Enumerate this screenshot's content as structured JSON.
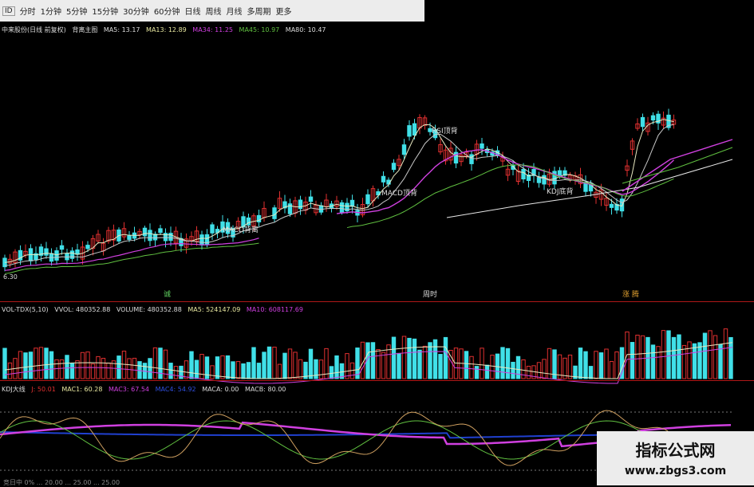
{
  "toolbar": {
    "items": [
      "分时",
      "1分钟",
      "5分钟",
      "15分钟",
      "30分钟",
      "60分钟",
      "日线",
      "周线",
      "月线",
      "多周期",
      "更多"
    ],
    "first_icon": "ID"
  },
  "main_info": {
    "stock": "中来股份(日线 前复权)",
    "indicator": "背离主图",
    "ma5": "MA5: 13.17",
    "ma13": "MA13: 12.89",
    "ma34": "MA34: 11.25",
    "ma45": "MA45: 10.97",
    "ma80": "MA80: 10.47"
  },
  "annotations": {
    "macd_low": "MACD背离",
    "macd_high": "MACD顶背",
    "rsi_top": "RSI顶背",
    "kdj": "KDJ底背",
    "price_low": "6.30"
  },
  "dates": [
    "诚",
    "周时",
    "涨 腾"
  ],
  "vol_info": {
    "name": "VOL-TDX(5,10)",
    "vvol": "VVOL: 480352.88",
    "volume": "VOLUME: 480352.88",
    "ma5": "MA5: 524147.09",
    "ma10": "MA10: 608117.69"
  },
  "kdj_info": {
    "name": "KDJ大线",
    "j": "J: 50.01",
    "mac1": "MAC1: 60.28",
    "mac3": "MAC3: 67.54",
    "mac4": "MAC4: 54.92",
    "maca": "MACA: 0.00",
    "macb": "MACB: 80.00"
  },
  "bottom_text": "竞日中 0% ... 20.00 ... 25.00 ... 25.00",
  "watermark": {
    "title": "指标公式网",
    "url": "www.zbgs3.com"
  },
  "colors": {
    "up": "#e03030",
    "down": "#40e0e8",
    "ma_yellow": "#e8e8c0",
    "ma_magenta": "#d040e0",
    "ma_green": "#60c040",
    "separator": "#b01818"
  }
}
